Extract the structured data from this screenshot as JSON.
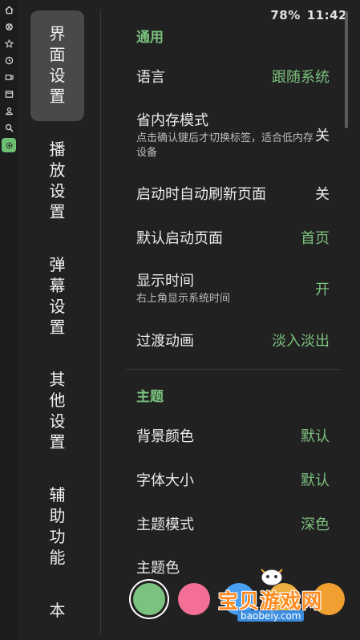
{
  "status": {
    "battery": "78%",
    "time": "11:42"
  },
  "rail_icons": [
    "home-icon",
    "bilibili-icon",
    "star-icon",
    "history-icon",
    "live-icon",
    "window-icon",
    "user-icon",
    "search-icon",
    "settings-icon"
  ],
  "categories": [
    {
      "label": "界\n面\n设\n置",
      "selected": true
    },
    {
      "label": "播\n放\n设\n置",
      "selected": false
    },
    {
      "label": "弹\n幕\n设\n置",
      "selected": false
    },
    {
      "label": "其\n他\n设\n置",
      "selected": false
    },
    {
      "label": "辅\n助\n功\n能",
      "selected": false
    },
    {
      "label": "本",
      "selected": false
    }
  ],
  "sections": {
    "general": "通用",
    "theme": "主题"
  },
  "settings": {
    "language": {
      "label": "语言",
      "value": "跟随系统"
    },
    "memory": {
      "label": "省内存模式",
      "desc": "点击确认键后才切换标签，适合低内存设备",
      "value": "关"
    },
    "auto_refresh": {
      "label": "启动时自动刷新页面",
      "value": "关"
    },
    "default_page": {
      "label": "默认启动页面",
      "value": "首页"
    },
    "show_time": {
      "label": "显示时间",
      "desc": "右上角显示系统时间",
      "value": "开"
    },
    "transition": {
      "label": "过渡动画",
      "value": "淡入淡出"
    },
    "bg_color": {
      "label": "背景颜色",
      "value": "默认"
    },
    "font_size": {
      "label": "字体大小",
      "value": "默认"
    },
    "theme_mode": {
      "label": "主题模式",
      "value": "深色"
    },
    "theme_color": {
      "label": "主题色"
    }
  },
  "theme_colors": [
    "#7cc27f",
    "#f36f95",
    "#4aa0f0",
    "#f0b040",
    "#f0a030"
  ],
  "watermark": {
    "text": "宝贝游戏网",
    "url": "baobeiy.com"
  },
  "colors": {
    "accent": "#7cc27f",
    "background": "#212121",
    "selected_bg": "#494949"
  }
}
